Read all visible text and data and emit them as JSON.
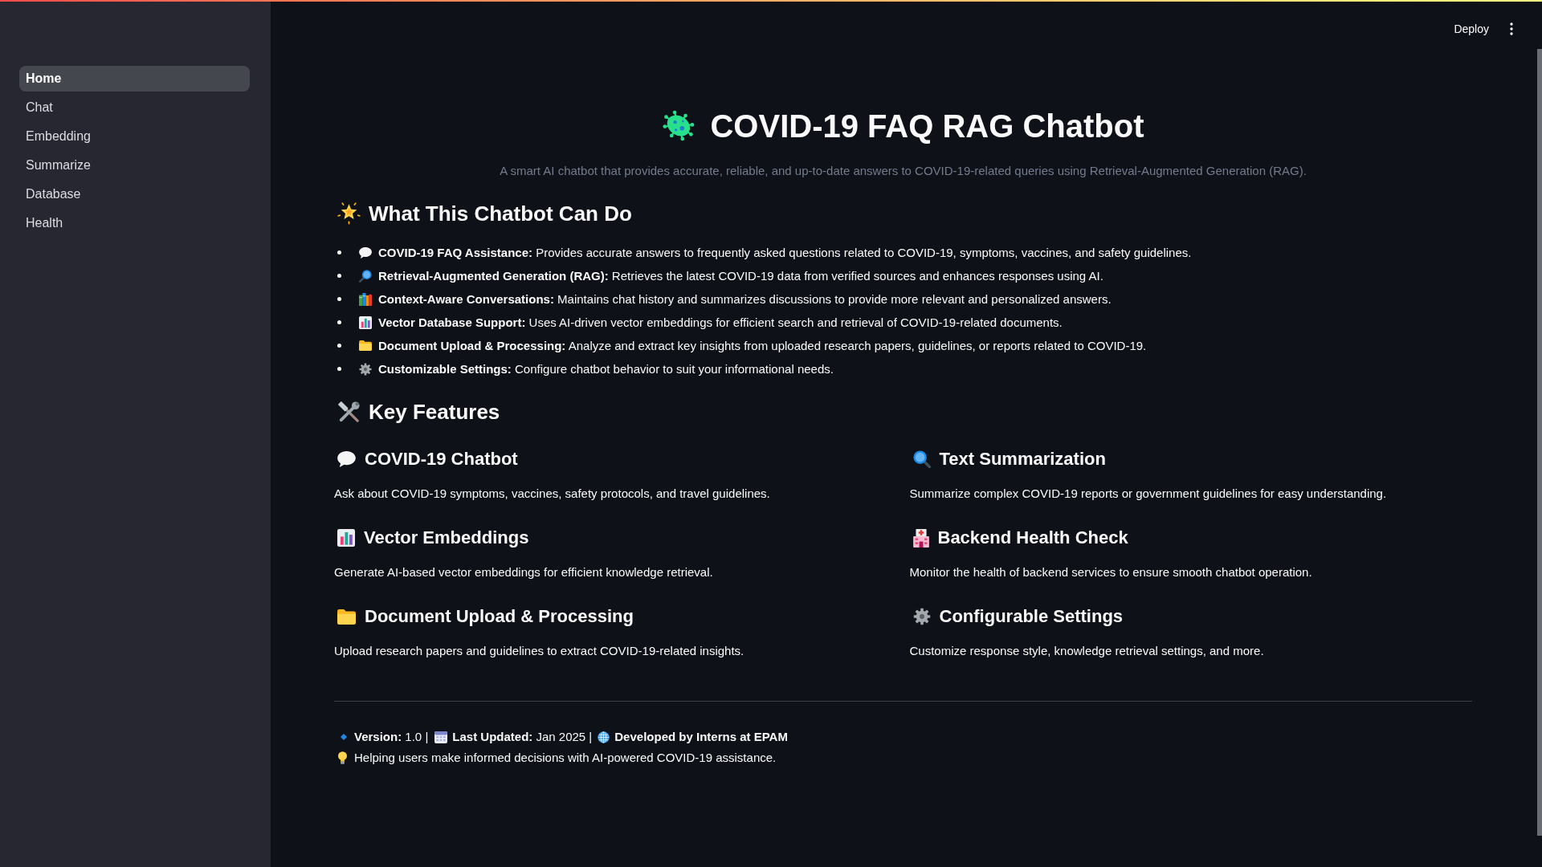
{
  "sidebar": {
    "items": [
      {
        "label": "Home",
        "selected": true
      },
      {
        "label": "Chat",
        "selected": false
      },
      {
        "label": "Embedding",
        "selected": false
      },
      {
        "label": "Summarize",
        "selected": false
      },
      {
        "label": "Database",
        "selected": false
      },
      {
        "label": "Health",
        "selected": false
      }
    ]
  },
  "header": {
    "deploy_button": "Deploy"
  },
  "hero": {
    "title": "COVID-19 FAQ RAG Chatbot",
    "subtitle": "A smart AI chatbot that provides accurate, reliable, and up-to-date answers to COVID-19-related queries using Retrieval-Augmented Generation (RAG)."
  },
  "capabilities": {
    "heading": "What This Chatbot Can Do",
    "items": [
      "**COVID-19 FAQ Assistance:** Provides accurate answers to frequently asked questions related to COVID-19, symptoms, vaccines, and safety guidelines.",
      "**Retrieval-Augmented Generation (RAG):** Retrieves the latest COVID-19 data from verified sources and enhances responses using AI.",
      "**Context-Aware Conversations:** Maintains chat history and summarizes discussions to provide more relevant and personalized answers.",
      "**Vector Database Support:** Uses AI-driven vector embeddings for efficient search and retrieval of COVID-19-related documents.",
      "**Document Upload & Processing:** Analyze and extract key insights from uploaded research papers, guidelines, or reports related to COVID-19.",
      "**Customizable Settings:** Configure chatbot behavior to suit your informational needs."
    ]
  },
  "key_features": {
    "heading": "Key Features",
    "items": [
      {
        "title": "COVID-19 Chatbot",
        "description": "Ask about COVID-19 symptoms, vaccines, safety protocols, and travel guidelines."
      },
      {
        "title": "Text Summarization",
        "description": "Summarize complex COVID-19 reports or government guidelines for easy understanding."
      },
      {
        "title": "Vector Embeddings",
        "description": "Generate AI-based vector embeddings for efficient knowledge retrieval."
      },
      {
        "title": "Backend Health Check",
        "description": "Monitor the health of backend services to ensure smooth chatbot operation."
      },
      {
        "title": "Document Upload & Processing",
        "description": "Upload research papers and guidelines to extract COVID-19-related insights."
      },
      {
        "title": "Configurable Settings",
        "description": "Customize response style, knowledge retrieval settings, and more."
      }
    ]
  },
  "footer": {
    "meta": [
      {
        "label": "Version:",
        "value": "1.0",
        "separator": "|"
      },
      {
        "label": "Last Updated:",
        "value": "Jan 2025",
        "separator": "|"
      },
      {
        "label": "Developed by Interns at EPAM"
      }
    ],
    "tagline": "Helping users make informed decisions with AI-powered COVID-19 assistance."
  }
}
